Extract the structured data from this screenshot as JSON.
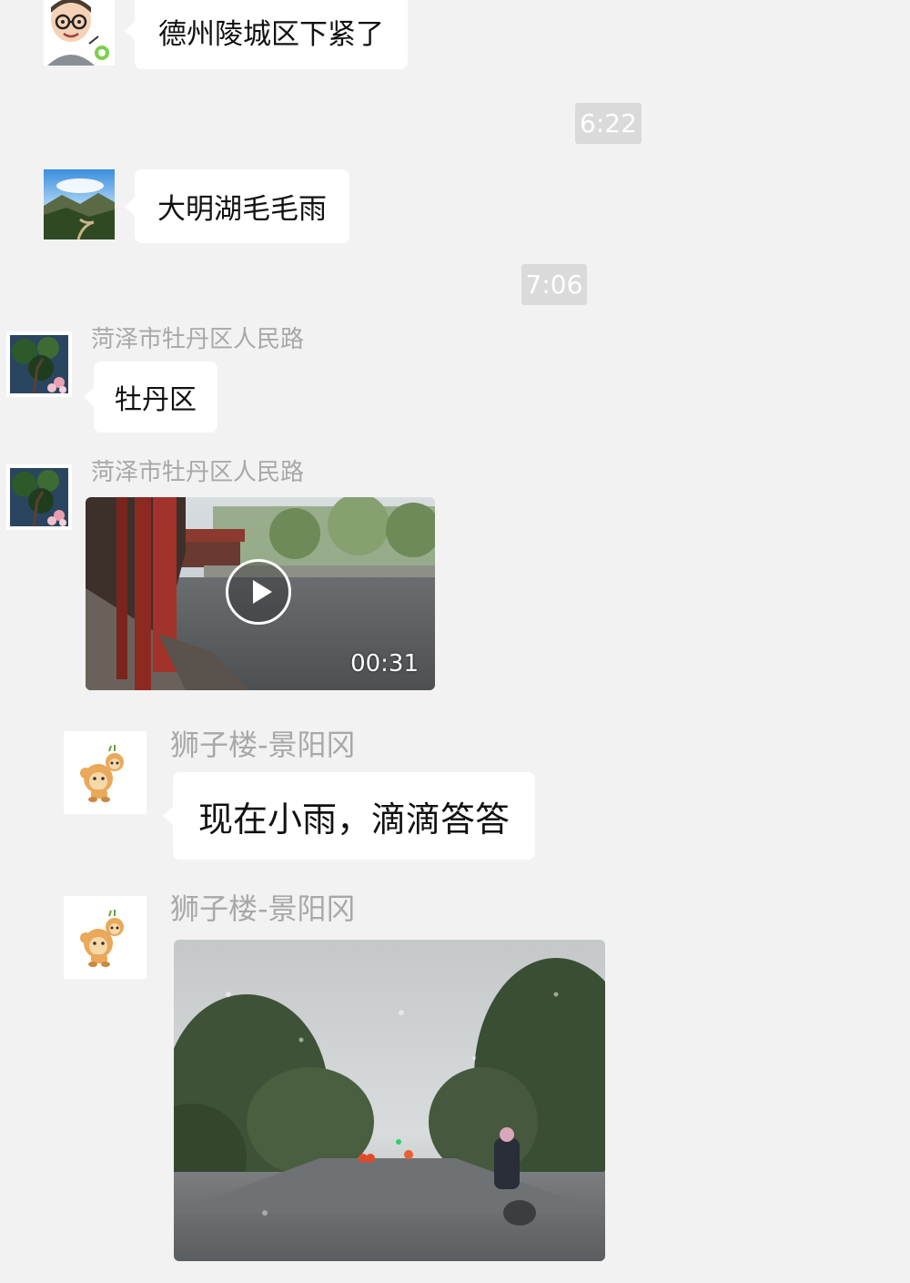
{
  "messages": [
    {
      "type": "text",
      "text": "德州陵城区下紧了"
    },
    {
      "type": "time",
      "text": "6:22"
    },
    {
      "type": "text",
      "text": "大明湖毛毛雨"
    },
    {
      "type": "time",
      "text": "7:06"
    },
    {
      "type": "text",
      "sender": "菏泽市牡丹区人民路",
      "text": "牡丹区"
    },
    {
      "type": "video",
      "sender": "菏泽市牡丹区人民路",
      "duration": "00:31",
      "play_icon": "play-icon"
    },
    {
      "type": "text",
      "sender": "狮子楼-景阳冈",
      "text": "现在小雨，滴滴答答"
    },
    {
      "type": "image",
      "sender": "狮子楼-景阳冈",
      "subject": "rainy-road-photo"
    }
  ],
  "colors": {
    "background": "#f2f2f2",
    "bubble": "#ffffff",
    "timestamp_bg": "#dadada",
    "sender_name": "#a8a8a8"
  }
}
